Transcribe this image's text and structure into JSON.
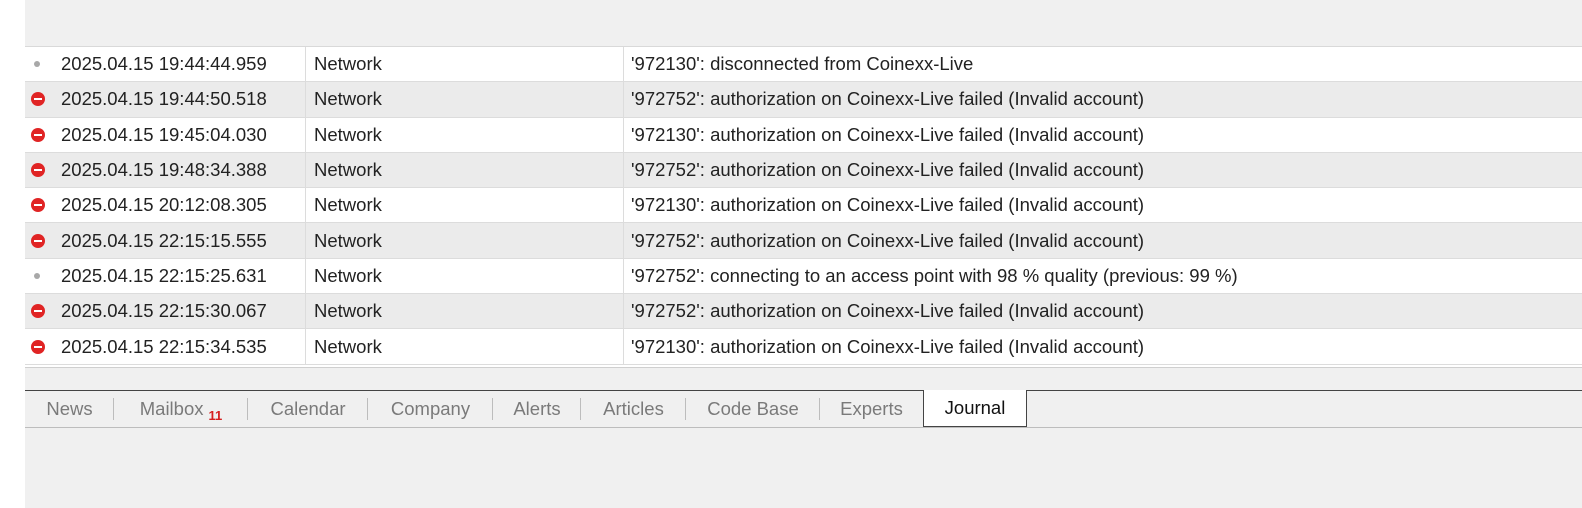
{
  "log": {
    "rows": [
      {
        "level": "info",
        "time": "2025.04.15 19:44:44.959",
        "source": "Network",
        "message": "'972130': disconnected from Coinexx-Live"
      },
      {
        "level": "error",
        "time": "2025.04.15 19:44:50.518",
        "source": "Network",
        "message": "'972752': authorization on Coinexx-Live failed (Invalid account)"
      },
      {
        "level": "error",
        "time": "2025.04.15 19:45:04.030",
        "source": "Network",
        "message": "'972130': authorization on Coinexx-Live failed (Invalid account)"
      },
      {
        "level": "error",
        "time": "2025.04.15 19:48:34.388",
        "source": "Network",
        "message": "'972752': authorization on Coinexx-Live failed (Invalid account)"
      },
      {
        "level": "error",
        "time": "2025.04.15 20:12:08.305",
        "source": "Network",
        "message": "'972130': authorization on Coinexx-Live failed (Invalid account)"
      },
      {
        "level": "error",
        "time": "2025.04.15 22:15:15.555",
        "source": "Network",
        "message": "'972752': authorization on Coinexx-Live failed (Invalid account)"
      },
      {
        "level": "info",
        "time": "2025.04.15 22:15:25.631",
        "source": "Network",
        "message": "'972752': connecting to an access point with 98 % quality (previous: 99 %)"
      },
      {
        "level": "error",
        "time": "2025.04.15 22:15:30.067",
        "source": "Network",
        "message": "'972752': authorization on Coinexx-Live failed (Invalid account)"
      },
      {
        "level": "error",
        "time": "2025.04.15 22:15:34.535",
        "source": "Network",
        "message": "'972130': authorization on Coinexx-Live failed (Invalid account)"
      }
    ]
  },
  "tabs": [
    {
      "label": "News"
    },
    {
      "label": "Mailbox",
      "badge": "11"
    },
    {
      "label": "Calendar"
    },
    {
      "label": "Company"
    },
    {
      "label": "Alerts"
    },
    {
      "label": "Articles"
    },
    {
      "label": "Code Base"
    },
    {
      "label": "Experts"
    },
    {
      "label": "Journal",
      "active": true
    }
  ],
  "colors": {
    "error_icon": "#e02424",
    "info_icon": "#a8a8a8",
    "badge": "#d62020"
  }
}
